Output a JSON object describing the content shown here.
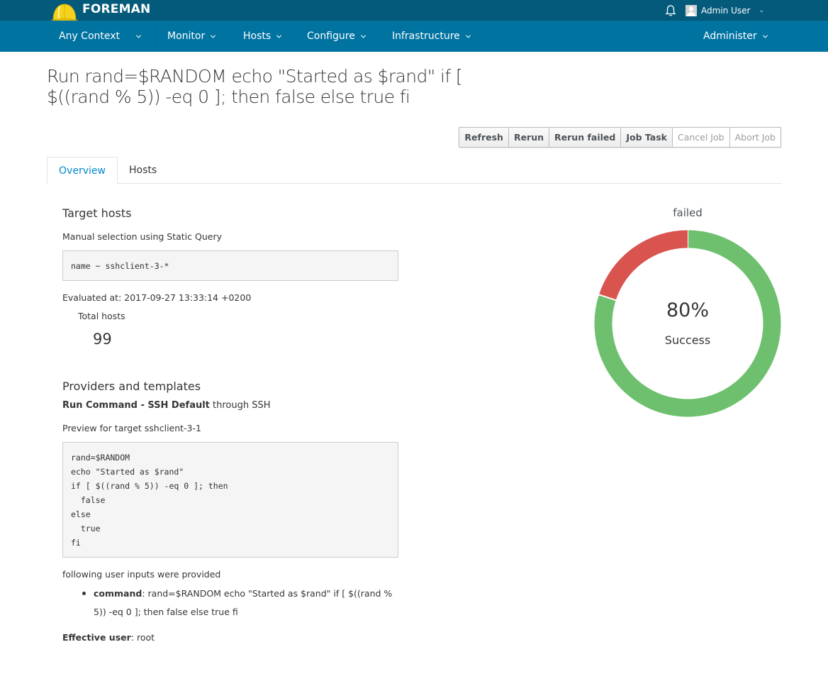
{
  "header": {
    "brand": "FOREMAN",
    "user_name": "Admin User"
  },
  "nav": {
    "context": "Any Context",
    "items": [
      "Monitor",
      "Hosts",
      "Configure",
      "Infrastructure"
    ],
    "right_item": "Administer"
  },
  "page": {
    "title": "Run rand=$RANDOM echo \"Started as $rand\" if [ $((rand % 5)) -eq 0 ]; then false else true fi"
  },
  "actions": {
    "refresh": "Refresh",
    "rerun": "Rerun",
    "rerun_failed": "Rerun failed",
    "job_task": "Job Task",
    "cancel_job": "Cancel Job",
    "abort_job": "Abort Job"
  },
  "tabs": {
    "overview": "Overview",
    "hosts": "Hosts"
  },
  "target": {
    "heading": "Target hosts",
    "selection": "Manual selection using Static Query",
    "query": "name ~ sshclient-3-*",
    "evaluated_at": "Evaluated at: 2017-09-27 13:33:14 +0200",
    "total_label": "Total hosts",
    "total_count": "99"
  },
  "providers": {
    "heading": "Providers and templates",
    "template_name": "Run Command - SSH Default",
    "through": " through SSH",
    "preview_label": "Preview for target sshclient-3-1",
    "preview_lines": [
      "rand=$RANDOM",
      "echo \"Started as $rand\"",
      "if [ $((rand % 5)) -eq 0 ]; then",
      "  false",
      "else",
      "  true",
      "fi"
    ],
    "inputs_label": "following user inputs were provided",
    "input_name": "command",
    "input_value": ": rand=$RANDOM echo \"Started as $rand\" if [ $((rand % 5)) -eq 0 ]; then false else true fi",
    "effective_user_label": "Effective user",
    "effective_user_value": ": root"
  },
  "chart_data": {
    "type": "pie",
    "title": "failed",
    "center_value": "80%",
    "center_label": "Success",
    "slices": [
      {
        "name": "Success",
        "value": 80,
        "color": "#6ec06e"
      },
      {
        "name": "Failed",
        "value": 20,
        "color": "#d9534f"
      }
    ]
  }
}
